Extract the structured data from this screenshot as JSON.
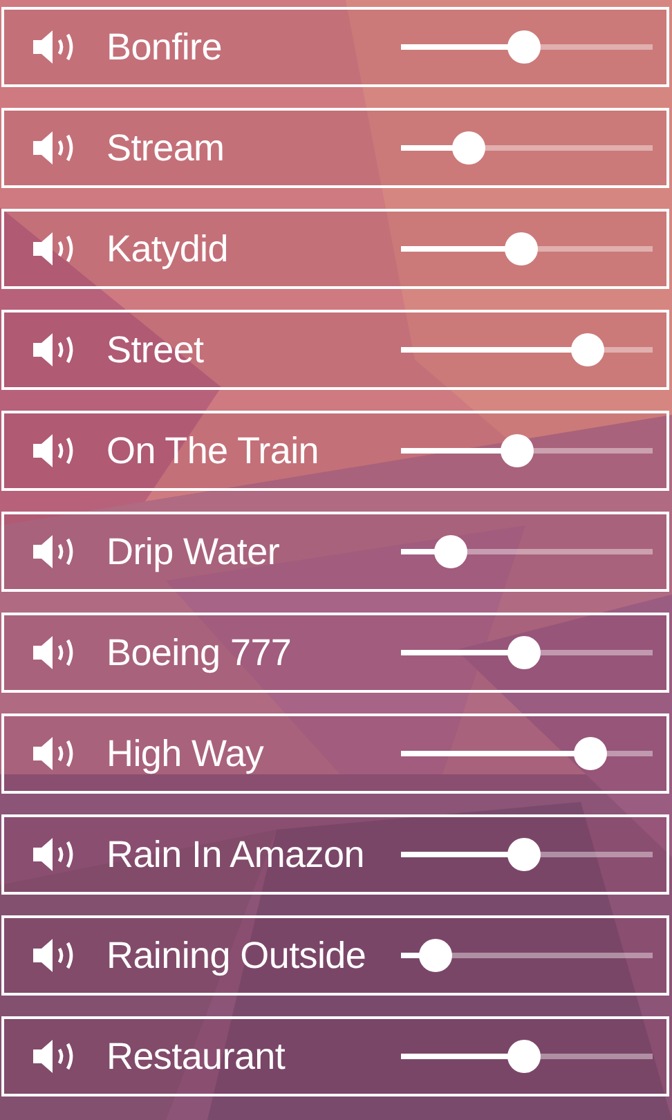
{
  "sounds": [
    {
      "name": "Bonfire",
      "level": 0.49
    },
    {
      "name": "Stream",
      "level": 0.27
    },
    {
      "name": "Katydid",
      "level": 0.48
    },
    {
      "name": "Street",
      "level": 0.74
    },
    {
      "name": "On The Train",
      "level": 0.46
    },
    {
      "name": "Drip Water",
      "level": 0.2
    },
    {
      "name": "Boeing 777",
      "level": 0.49
    },
    {
      "name": "High Way",
      "level": 0.75
    },
    {
      "name": "Rain In Amazon",
      "level": 0.49
    },
    {
      "name": "Raining Outside",
      "level": 0.14
    },
    {
      "name": "Restaurant",
      "level": 0.49
    }
  ]
}
